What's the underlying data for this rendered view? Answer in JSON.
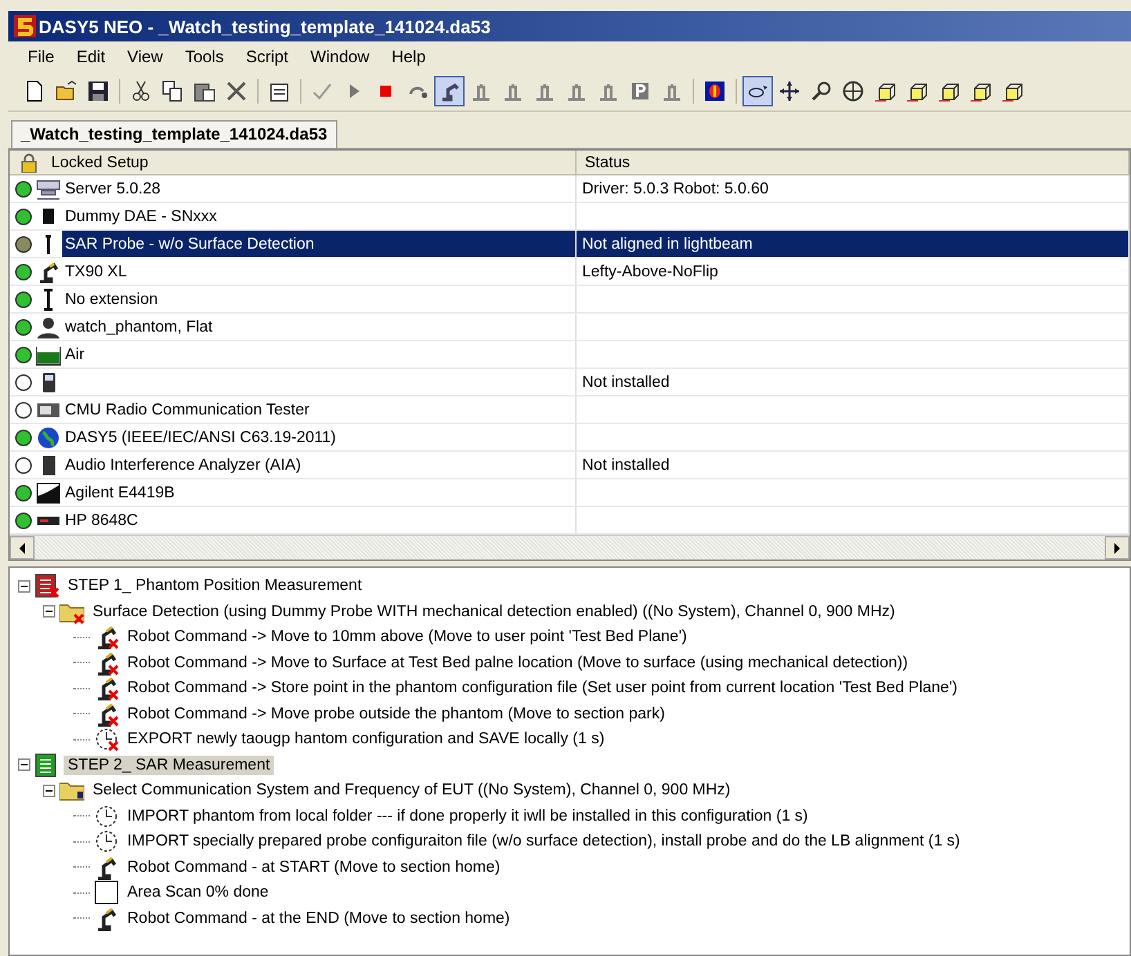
{
  "window": {
    "title": "DASY5 NEO - _Watch_testing_template_141024.da53"
  },
  "menu": [
    "File",
    "Edit",
    "View",
    "Tools",
    "Script",
    "Window",
    "Help"
  ],
  "toolbar": [
    [
      {
        "kind": "new",
        "pressed": false
      },
      {
        "kind": "open",
        "pressed": false
      },
      {
        "kind": "save",
        "pressed": false
      }
    ],
    [
      {
        "kind": "cut",
        "pressed": false
      },
      {
        "kind": "copy",
        "pressed": false
      },
      {
        "kind": "paste",
        "pressed": false
      },
      {
        "kind": "delete",
        "pressed": false
      }
    ],
    [
      {
        "kind": "properties",
        "pressed": false
      }
    ],
    [
      {
        "kind": "check",
        "pressed": false
      },
      {
        "kind": "play",
        "pressed": false
      },
      {
        "kind": "stop",
        "pressed": false
      },
      {
        "kind": "undo",
        "pressed": false
      },
      {
        "kind": "robot",
        "pressed": true
      },
      {
        "kind": "stand",
        "pressed": false
      },
      {
        "kind": "stand",
        "pressed": false
      },
      {
        "kind": "stand",
        "pressed": false
      },
      {
        "kind": "stand",
        "pressed": false
      },
      {
        "kind": "stand",
        "pressed": false
      },
      {
        "kind": "park",
        "pressed": false
      },
      {
        "kind": "stand",
        "pressed": false
      }
    ],
    [
      {
        "kind": "field",
        "pressed": false
      }
    ],
    [
      {
        "kind": "eye",
        "pressed": true
      },
      {
        "kind": "move",
        "pressed": false
      },
      {
        "kind": "zoom",
        "pressed": false
      },
      {
        "kind": "target",
        "pressed": false
      },
      {
        "kind": "cube",
        "pressed": false
      },
      {
        "kind": "cube",
        "pressed": false
      },
      {
        "kind": "cube",
        "pressed": false
      },
      {
        "kind": "cube",
        "pressed": false
      },
      {
        "kind": "cube",
        "pressed": false
      }
    ]
  ],
  "tabs": [
    {
      "label": "_Watch_testing_template_141024.da53",
      "selected": true
    }
  ],
  "table": {
    "columns": [
      "Locked Setup",
      "Status"
    ],
    "rows": [
      {
        "color": "#30c030",
        "kind": "server",
        "name": "Server 5.0.28",
        "value": "Driver: 5.0.3 Robot: 5.0.60",
        "selected": false
      },
      {
        "color": "#30c030",
        "kind": "dae",
        "name": "Dummy DAE - SNxxx",
        "selected": false
      },
      {
        "color": "#8a8a60",
        "kind": "probe",
        "name": "SAR Probe - w/o Surface Detection",
        "value": "Not aligned in lightbeam",
        "selected": true
      },
      {
        "color": "#30c030",
        "kind": "robot",
        "name": "TX90 XL",
        "value": "Lefty-Above-NoFlip",
        "selected": false
      },
      {
        "color": "#30c030",
        "kind": "extension",
        "name": "No extension",
        "selected": false
      },
      {
        "color": "#30c030",
        "kind": "phantom",
        "name": "watch_phantom, Flat",
        "selected": false
      },
      {
        "color": "#30c030",
        "kind": "medium",
        "name": "Air",
        "selected": false
      },
      {
        "color": "#ffffff",
        "kind": "phone",
        "value": "Not installed",
        "selected": false
      },
      {
        "color": "#ffffff",
        "kind": "tester",
        "name": "CMU Radio Communication Tester",
        "selected": false
      },
      {
        "color": "#30c030",
        "kind": "globe",
        "name": "DASY5 (IEEE/IEC/ANSI C63.19-2011)",
        "selected": false
      },
      {
        "color": "#ffffff",
        "kind": "device",
        "name": "Audio Interference Analyzer (AIA)",
        "value": "Not installed",
        "selected": false
      },
      {
        "color": "#30c030",
        "kind": "meter",
        "name": "Agilent E4419B",
        "selected": false
      },
      {
        "color": "#30c030",
        "kind": "generator",
        "name": "HP 8648C",
        "selected": false
      }
    ]
  },
  "tree": [
    {
      "kind": "step",
      "error": true,
      "selected": false,
      "expanded": true,
      "label": "STEP 1_ Phantom Position Measurement",
      "children": [
        {
          "kind": "group",
          "error": true,
          "selected": false,
          "expanded": true,
          "label": "Surface Detection (using Dummy Probe WITH mechanical detection enabled) ((No System), Channel 0, 900 MHz)",
          "children": [
            {
              "kind": "robot",
              "error": true,
              "selected": false,
              "label": "Robot Command -> Move to 10mm above (Move to user point 'Test Bed Plane')"
            },
            {
              "kind": "robot",
              "error": true,
              "selected": false,
              "label": "Robot Command -> Move to Surface at Test Bed palne location (Move to surface (using mechanical detection))"
            },
            {
              "kind": "robot",
              "error": true,
              "selected": false,
              "label": "Robot Command -> Store point in the phantom configuration file (Set user point from current location 'Test Bed Plane')"
            },
            {
              "kind": "robot",
              "error": true,
              "selected": false,
              "label": "Robot Command -> Move probe outside the phantom (Move to section park)"
            },
            {
              "kind": "timer",
              "error": true,
              "selected": false,
              "label": "EXPORT newly taougp hantom configuration and SAVE locally (1 s)"
            }
          ]
        }
      ]
    },
    {
      "kind": "step",
      "error": false,
      "selected": true,
      "expanded": true,
      "label": "STEP 2_ SAR Measurement",
      "children": [
        {
          "kind": "group",
          "error": false,
          "selected": false,
          "expanded": true,
          "label": "Select Communication System and Frequency of EUT ((No System), Channel 0, 900 MHz)",
          "children": [
            {
              "kind": "timer",
              "error": false,
              "selected": false,
              "label": "IMPORT phantom from local folder --- if done properly it iwll be installed in this configuration (1 s)"
            },
            {
              "kind": "timer",
              "error": false,
              "selected": false,
              "label": "IMPORT specially prepared probe configuraiton file (w/o surface detection), install probe and do the LB alignment (1 s)"
            },
            {
              "kind": "robot",
              "error": false,
              "selected": false,
              "label": "Robot Command - at START (Move to section home)"
            },
            {
              "kind": "scan",
              "error": false,
              "selected": false,
              "label": "Area Scan 0% done"
            },
            {
              "kind": "robot",
              "error": false,
              "selected": false,
              "label": "Robot Command - at the END (Move to section home)"
            }
          ]
        }
      ]
    }
  ]
}
